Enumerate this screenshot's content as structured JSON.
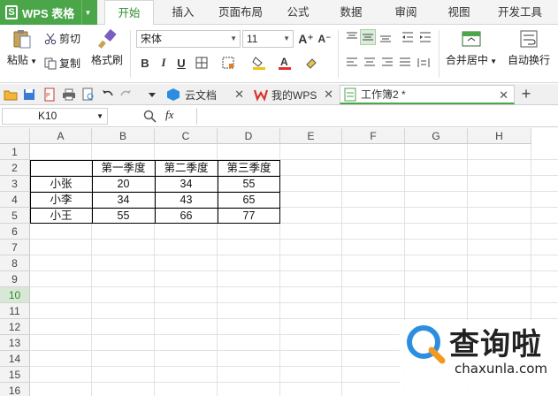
{
  "app": {
    "name": "WPS 表格",
    "logo_letter": "S"
  },
  "menu": {
    "tabs": [
      {
        "label": "开始",
        "active": true
      },
      {
        "label": "插入"
      },
      {
        "label": "页面布局"
      },
      {
        "label": "公式"
      },
      {
        "label": "数据"
      },
      {
        "label": "审阅"
      },
      {
        "label": "视图"
      },
      {
        "label": "开发工具"
      }
    ]
  },
  "ribbon": {
    "paste_label": "粘贴",
    "cut_label": "剪切",
    "copy_label": "复制",
    "format_painter_label": "格式刷",
    "font_name": "宋体",
    "font_size": "11",
    "bold": "B",
    "italic": "I",
    "underline": "U",
    "merge_center_label": "合并居中",
    "wrap_text_label": "自动换行"
  },
  "doc_tabs": [
    {
      "label": "云文档",
      "icon": "cloud-doc-icon"
    },
    {
      "label": "我的WPS",
      "icon": "wps-logo-icon"
    },
    {
      "label": "工作簿2 *",
      "icon": "sheet-icon",
      "active": true
    }
  ],
  "formula_bar": {
    "cell_ref": "K10",
    "fx": "fx",
    "value": ""
  },
  "grid": {
    "columns": [
      "A",
      "B",
      "C",
      "D",
      "E",
      "F",
      "G",
      "H"
    ],
    "rows": [
      "1",
      "2",
      "3",
      "4",
      "5",
      "6",
      "7",
      "8",
      "9",
      "10",
      "11",
      "12",
      "13",
      "14",
      "15",
      "16"
    ],
    "active_row": "10",
    "table": {
      "headers": [
        "",
        "第一季度",
        "第二季度",
        "第三季度"
      ],
      "rows": [
        {
          "name": "小张",
          "values": [
            "20",
            "34",
            "55"
          ]
        },
        {
          "name": "小李",
          "values": [
            "34",
            "43",
            "65"
          ]
        },
        {
          "name": "小王",
          "values": [
            "55",
            "66",
            "77"
          ]
        }
      ]
    }
  },
  "watermark": {
    "title": "查询啦",
    "subtitle": "chaxunla.com"
  },
  "colors": {
    "accent": "#4ba549",
    "active_tab_text": "#2e8b2e",
    "watermark_blue": "#2d8ee0",
    "watermark_orange": "#f39a1e"
  }
}
